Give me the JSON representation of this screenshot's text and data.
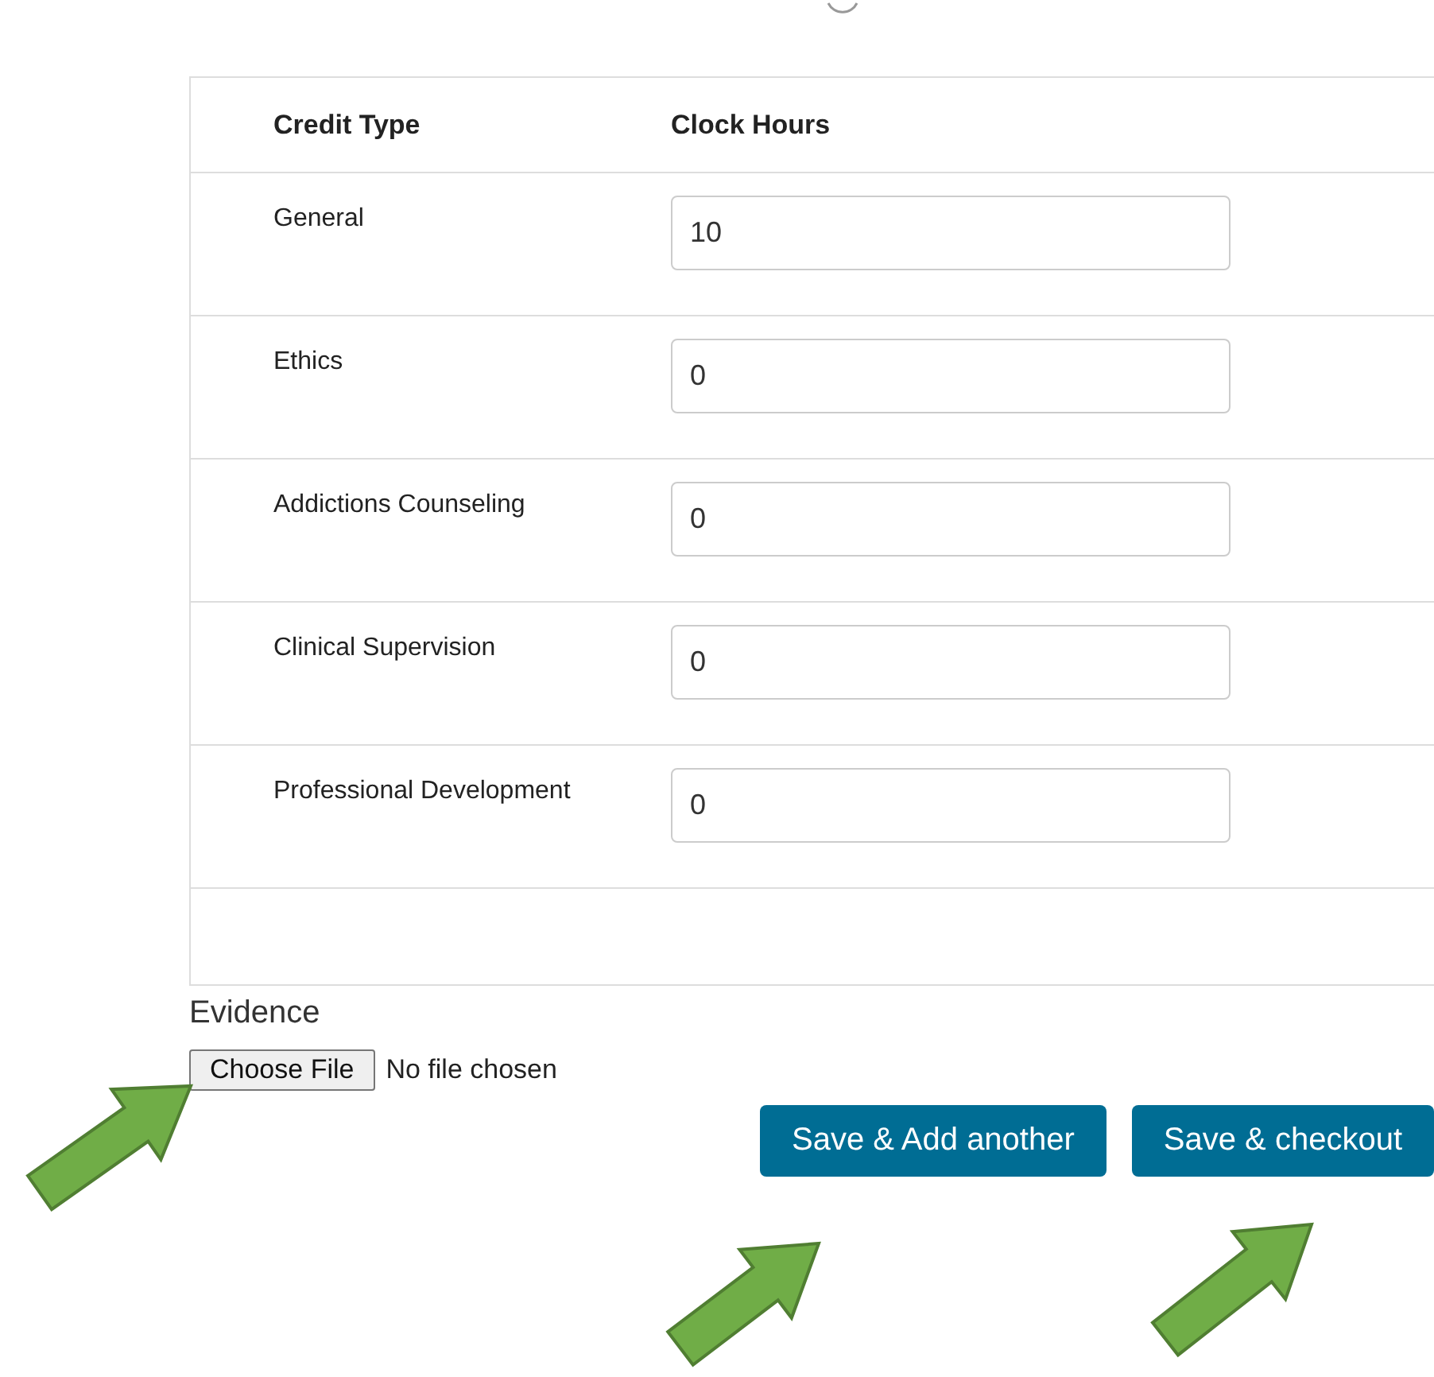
{
  "table": {
    "columns": [
      "Credit Type",
      "Clock Hours"
    ],
    "rows": [
      {
        "credit_type": "General",
        "hours": "10"
      },
      {
        "credit_type": "Ethics",
        "hours": "0"
      },
      {
        "credit_type": "Addictions Counseling",
        "hours": "0"
      },
      {
        "credit_type": "Clinical Supervision",
        "hours": "0"
      },
      {
        "credit_type": "Professional Development",
        "hours": "0"
      }
    ]
  },
  "evidence": {
    "label": "Evidence",
    "button": "Choose File",
    "status": "No file chosen"
  },
  "buttons": [
    "Save & Add another",
    "Save & checkout"
  ]
}
